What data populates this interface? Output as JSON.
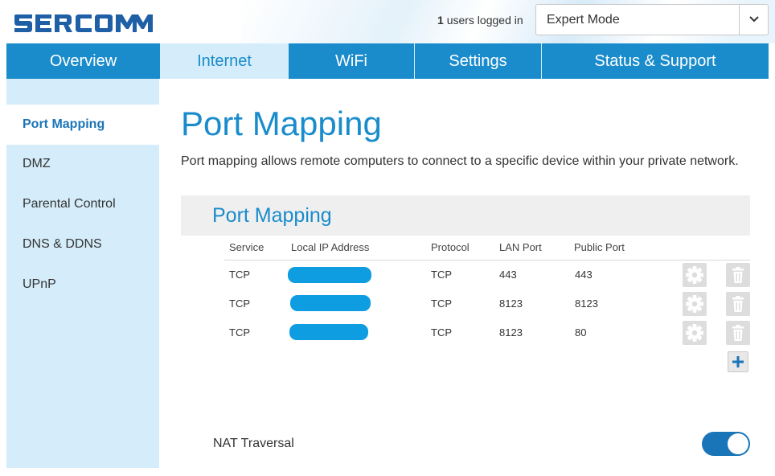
{
  "header": {
    "logo_text": "SERCOMM",
    "users_count": "1",
    "users_label": "users logged in",
    "mode_selected": "Expert Mode"
  },
  "nav": {
    "tabs": [
      {
        "label": "Overview"
      },
      {
        "label": "Internet"
      },
      {
        "label": "WiFi"
      },
      {
        "label": "Settings"
      },
      {
        "label": "Status & Support"
      }
    ]
  },
  "sidebar": {
    "items": [
      {
        "label": "Port Mapping"
      },
      {
        "label": "DMZ"
      },
      {
        "label": "Parental Control"
      },
      {
        "label": "DNS & DDNS"
      },
      {
        "label": "UPnP"
      }
    ]
  },
  "page": {
    "title": "Port Mapping",
    "description": "Port mapping allows remote computers to connect to a specific device within your private network."
  },
  "panel": {
    "title": "Port Mapping",
    "columns": [
      "Service",
      "Local IP Address",
      "Protocol",
      "LAN Port",
      "Public Port"
    ],
    "rows": [
      {
        "service": "TCP",
        "local_ip": "",
        "protocol": "TCP",
        "lan_port": "443",
        "public_port": "443"
      },
      {
        "service": "TCP",
        "local_ip": "",
        "protocol": "TCP",
        "lan_port": "8123",
        "public_port": "8123"
      },
      {
        "service": "TCP",
        "local_ip": "",
        "protocol": "TCP",
        "lan_port": "8123",
        "public_port": "80"
      }
    ],
    "row_icons": [
      "gear-icon",
      "trash-icon"
    ],
    "add_icon": "plus-icon"
  },
  "nat": {
    "label": "NAT Traversal",
    "enabled": true
  },
  "colors": {
    "brand_blue": "#1a8ccb",
    "nav_active_bg": "#d5edfa",
    "sidebar_bg": "#d5edfa",
    "redaction_blue": "#0d9de0",
    "toggle_on": "#1a75b8"
  }
}
